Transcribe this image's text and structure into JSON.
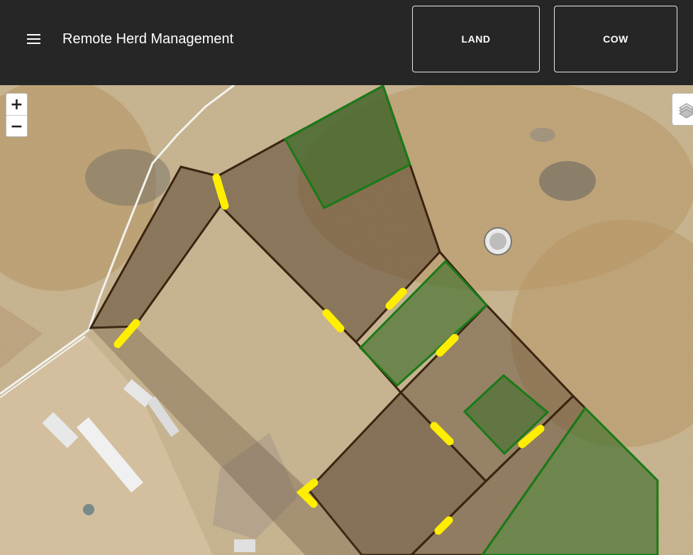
{
  "header": {
    "title": "Remote Herd Management",
    "land_button": "LAND",
    "cow_button": "COW"
  },
  "map": {
    "zoom_in": "+",
    "zoom_out": "−",
    "layers_icon": "layers-icon"
  },
  "colors": {
    "appbar": "#262626",
    "paddock_fill": "#5a4632",
    "paddock_stroke": "#3b2410",
    "green_fill": "#3f6e2b",
    "green_stroke": "#1a7a17",
    "gate": "#ffee00"
  }
}
